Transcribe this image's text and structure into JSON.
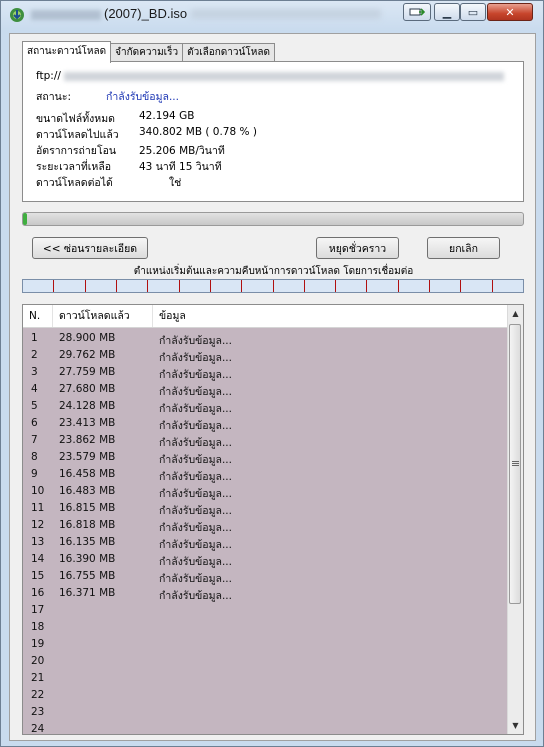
{
  "window": {
    "title_suffix": "(2007)_BD.iso",
    "buttons": {
      "minimize": "▁",
      "maximize": "▭",
      "close": "✕"
    }
  },
  "tabs": [
    {
      "label": "สถานะดาวน์โหลด"
    },
    {
      "label": "จำกัดความเร็ว"
    },
    {
      "label": "ตัวเลือกดาวน์โหลด"
    }
  ],
  "status": {
    "ftp_label": "ftp://",
    "status_label": "สถานะ:",
    "status_value": "กำลังรับข้อมูล...",
    "fields": [
      {
        "label": "ขนาดไฟล์ทั้งหมด",
        "value": "42.194  GB"
      },
      {
        "label": "ดาวน์โหลดไปแล้ว",
        "value": "340.802  MB  ( 0.78 % )"
      },
      {
        "label": "อัตราการถ่ายโอน",
        "value": "25.206  MB/วินาที"
      },
      {
        "label": "ระยะเวลาที่เหลือ",
        "value": "43 นาที 15 วินาที"
      },
      {
        "label": "ดาวน์โหลดต่อได้",
        "value": "ใช่"
      }
    ],
    "progress_fraction": 0.0078
  },
  "buttons": {
    "hide_details": "<< ซ่อนรายละเอียด",
    "pause": "หยุดชั่วคราว",
    "cancel": "ยกเลิก"
  },
  "segments_caption": "ตำแหน่งเริ่มต้นและความคืบหน้าการดาวน์โหลด โดยการเชื่อมต่อ",
  "segment_count": 16,
  "connections": {
    "headers": [
      "N.",
      "ดาวน์โหลดแล้ว",
      "ข้อมูล"
    ],
    "rows": [
      {
        "n": "1",
        "downloaded": "28.900  MB",
        "info": "กำลังรับข้อมูล..."
      },
      {
        "n": "2",
        "downloaded": "29.762  MB",
        "info": "กำลังรับข้อมูล..."
      },
      {
        "n": "3",
        "downloaded": "27.759  MB",
        "info": "กำลังรับข้อมูล..."
      },
      {
        "n": "4",
        "downloaded": "27.680  MB",
        "info": "กำลังรับข้อมูล..."
      },
      {
        "n": "5",
        "downloaded": "24.128  MB",
        "info": "กำลังรับข้อมูล..."
      },
      {
        "n": "6",
        "downloaded": "23.413  MB",
        "info": "กำลังรับข้อมูล..."
      },
      {
        "n": "7",
        "downloaded": "23.862  MB",
        "info": "กำลังรับข้อมูล..."
      },
      {
        "n": "8",
        "downloaded": "23.579  MB",
        "info": "กำลังรับข้อมูล..."
      },
      {
        "n": "9",
        "downloaded": "16.458  MB",
        "info": "กำลังรับข้อมูล..."
      },
      {
        "n": "10",
        "downloaded": "16.483  MB",
        "info": "กำลังรับข้อมูล..."
      },
      {
        "n": "11",
        "downloaded": "16.815  MB",
        "info": "กำลังรับข้อมูล..."
      },
      {
        "n": "12",
        "downloaded": "16.818  MB",
        "info": "กำลังรับข้อมูล..."
      },
      {
        "n": "13",
        "downloaded": "16.135  MB",
        "info": "กำลังรับข้อมูล..."
      },
      {
        "n": "14",
        "downloaded": "16.390  MB",
        "info": "กำลังรับข้อมูล..."
      },
      {
        "n": "15",
        "downloaded": "16.755  MB",
        "info": "กำลังรับข้อมูล..."
      },
      {
        "n": "16",
        "downloaded": "16.371  MB",
        "info": "กำลังรับข้อมูล..."
      },
      {
        "n": "17",
        "downloaded": "",
        "info": ""
      },
      {
        "n": "18",
        "downloaded": "",
        "info": ""
      },
      {
        "n": "19",
        "downloaded": "",
        "info": ""
      },
      {
        "n": "20",
        "downloaded": "",
        "info": ""
      },
      {
        "n": "21",
        "downloaded": "",
        "info": ""
      },
      {
        "n": "22",
        "downloaded": "",
        "info": ""
      },
      {
        "n": "23",
        "downloaded": "",
        "info": ""
      },
      {
        "n": "24",
        "downloaded": "",
        "info": ""
      }
    ]
  },
  "colors": {
    "list_background": "#c4b6c0",
    "segment_divider": "#b01010",
    "status_value": "#1933b3"
  },
  "icons": {
    "app": "download-manager-icon",
    "scroll_up": "scroll-up-arrow-icon",
    "scroll_down": "scroll-down-arrow-icon"
  }
}
